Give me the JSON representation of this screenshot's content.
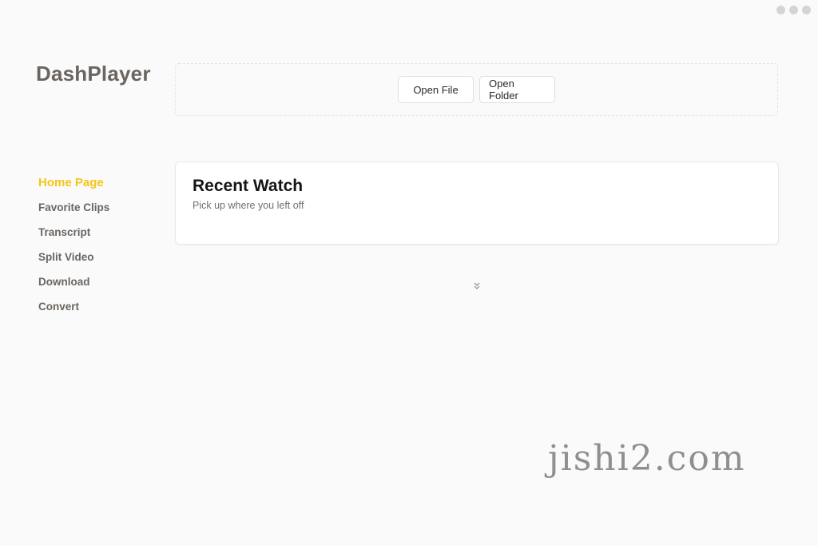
{
  "window": {
    "controls": [
      "window-dot-icon",
      "window-dot-icon",
      "window-dot-icon"
    ],
    "control_color": "#d4d4d4"
  },
  "brand": {
    "name": "DashPlayer",
    "color": "#6b6560"
  },
  "sidebar": {
    "items": [
      {
        "label": "Home Page",
        "active": true
      },
      {
        "label": "Favorite Clips",
        "active": false
      },
      {
        "label": "Transcript",
        "active": false
      },
      {
        "label": "Split Video",
        "active": false
      },
      {
        "label": "Download",
        "active": false
      },
      {
        "label": "Convert",
        "active": false
      }
    ],
    "active_color": "#f5c518"
  },
  "open_area": {
    "open_file_label": "Open File",
    "open_folder_label": "Open Folder"
  },
  "recent": {
    "title": "Recent Watch",
    "subtitle": "Pick up where you left off",
    "expand_icon": "double-chevron-down-icon"
  },
  "watermark": {
    "text": "jishi2.com"
  }
}
